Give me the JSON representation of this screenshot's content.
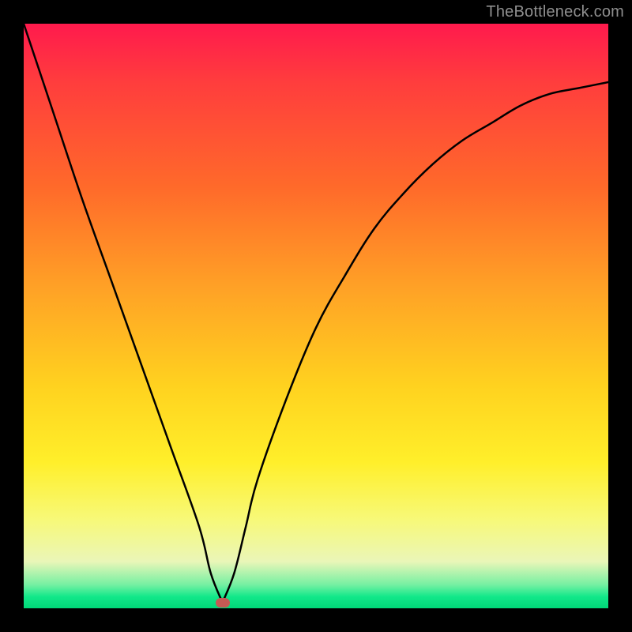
{
  "watermark": "TheBottleneck.com",
  "chart_data": {
    "type": "line",
    "title": "",
    "xlabel": "",
    "ylabel": "",
    "xlim": [
      0,
      100
    ],
    "ylim": [
      0,
      100
    ],
    "grid": false,
    "legend": false,
    "annotations": [
      {
        "name": "optimal-point-marker",
        "x": 34,
        "y": 1
      }
    ],
    "series": [
      {
        "name": "bottleneck-curve",
        "type": "line",
        "x": [
          0,
          5,
          10,
          15,
          20,
          25,
          30,
          32,
          34,
          36,
          38,
          40,
          45,
          50,
          55,
          60,
          65,
          70,
          75,
          80,
          85,
          90,
          95,
          100
        ],
        "y": [
          100,
          85,
          70,
          56,
          42,
          28,
          14,
          6,
          1,
          6,
          14,
          22,
          36,
          48,
          57,
          65,
          71,
          76,
          80,
          83,
          86,
          88,
          89,
          90
        ]
      }
    ],
    "background_gradient": {
      "direction": "vertical",
      "stops": [
        {
          "pos": 0.0,
          "color": "#ff1a4d"
        },
        {
          "pos": 0.28,
          "color": "#ff6a2a"
        },
        {
          "pos": 0.62,
          "color": "#ffd21f"
        },
        {
          "pos": 0.85,
          "color": "#f7f97a"
        },
        {
          "pos": 0.96,
          "color": "#74f0a2"
        },
        {
          "pos": 1.0,
          "color": "#00d878"
        }
      ]
    }
  }
}
